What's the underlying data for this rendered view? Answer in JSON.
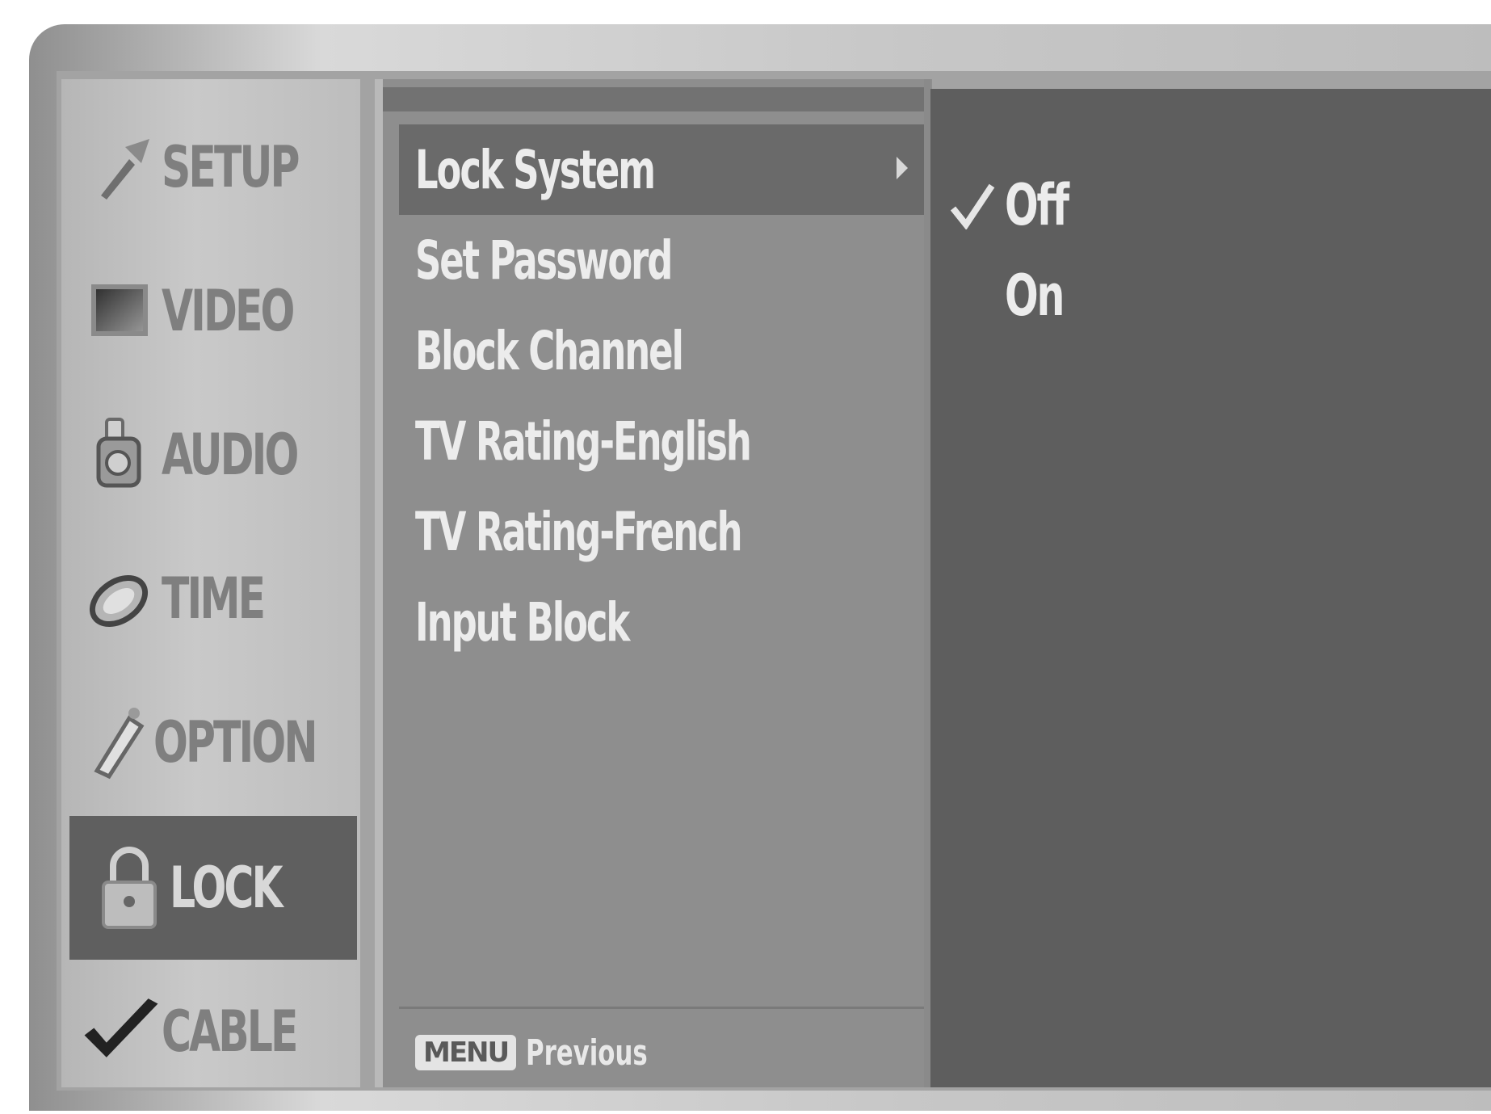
{
  "sidebar": {
    "items": [
      {
        "label": "SETUP",
        "icon": "wrench-icon"
      },
      {
        "label": "VIDEO",
        "icon": "video-icon"
      },
      {
        "label": "AUDIO",
        "icon": "audio-icon"
      },
      {
        "label": "TIME",
        "icon": "clock-icon"
      },
      {
        "label": "OPTION",
        "icon": "option-icon"
      },
      {
        "label": "LOCK",
        "icon": "lock-icon",
        "active": true
      },
      {
        "label": "CABLE",
        "icon": "checkmark-icon"
      }
    ]
  },
  "menu": {
    "items": [
      {
        "label": "Lock System",
        "selected": true
      },
      {
        "label": "Set Password"
      },
      {
        "label": "Block Channel"
      },
      {
        "label": "TV Rating-English"
      },
      {
        "label": "TV Rating-French"
      },
      {
        "label": "Input Block"
      }
    ],
    "footer": {
      "key": "MENU",
      "action": "Previous"
    }
  },
  "options": {
    "items": [
      {
        "label": "Off",
        "checked": true
      },
      {
        "label": "On",
        "checked": false
      }
    ]
  },
  "colors": {
    "sidebar_bg": "#c2c2c2",
    "sidebar_active": "#5f5f5f",
    "menu_bg": "#8e8e8e",
    "menu_selected": "#6a6a6a",
    "options_bg": "#5e5e5e",
    "text_light": "#ececec"
  }
}
